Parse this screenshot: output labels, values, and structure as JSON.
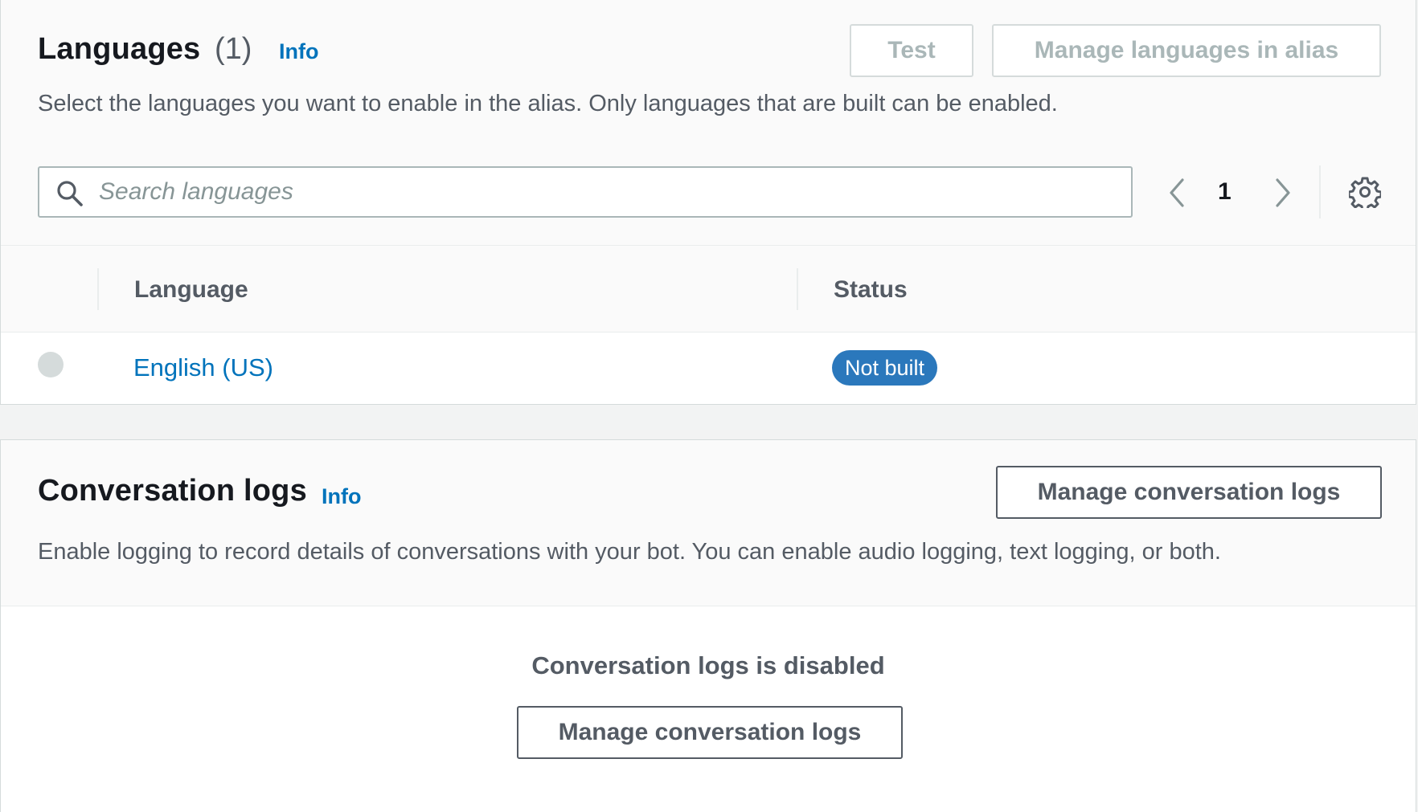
{
  "languages_panel": {
    "title": "Languages",
    "count": "(1)",
    "info_label": "Info",
    "description": "Select the languages you want to enable in the alias. Only languages that are built can be enabled.",
    "test_button": "Test",
    "manage_languages_button": "Manage languages in alias",
    "search": {
      "placeholder": "Search languages",
      "value": ""
    },
    "pagination": {
      "current_page": "1"
    },
    "table": {
      "columns": [
        "Language",
        "Status"
      ],
      "rows": [
        {
          "language": "English (US)",
          "status": "Not built"
        }
      ]
    }
  },
  "logs_panel": {
    "title": "Conversation logs",
    "info_label": "Info",
    "description": "Enable logging to record details of conversations with your bot. You can enable audio logging, text logging, or both.",
    "manage_button": "Manage conversation logs",
    "empty_state": {
      "title": "Conversation logs is disabled",
      "button": "Manage conversation logs"
    }
  },
  "colors": {
    "link": "#0073bb",
    "badge": "#2b78bc",
    "text_secondary": "#545b64"
  },
  "icons": [
    "search-icon",
    "chevron-left-icon",
    "chevron-right-icon",
    "gear-icon"
  ]
}
